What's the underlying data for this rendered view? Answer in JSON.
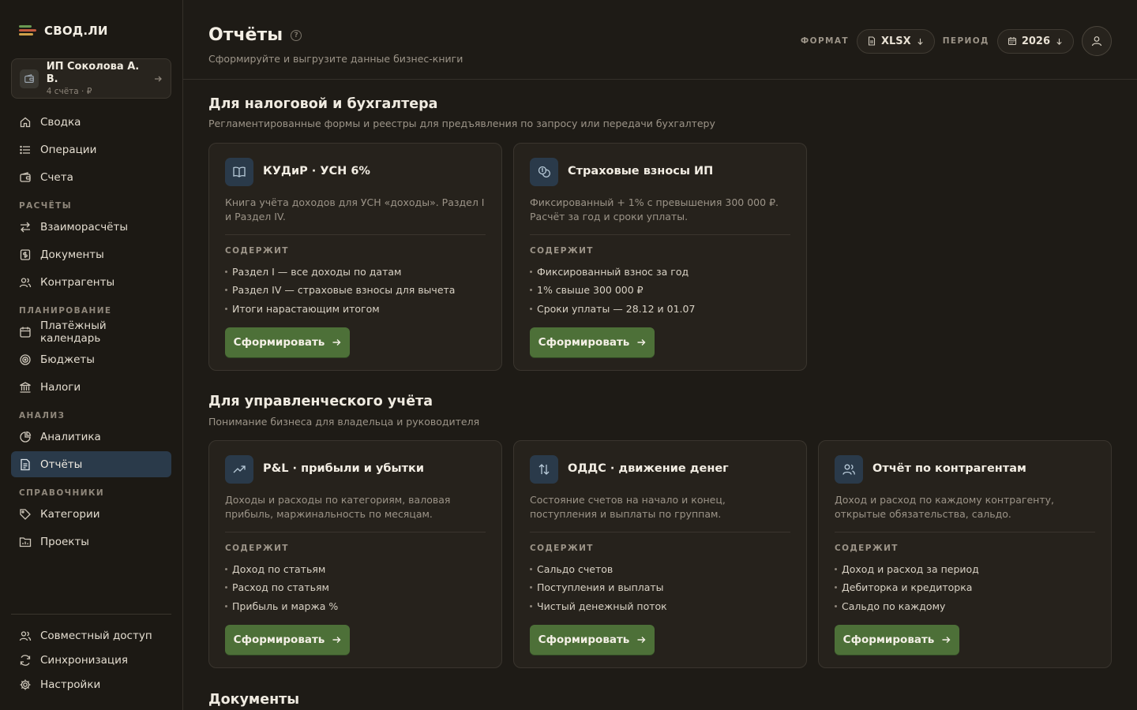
{
  "app": {
    "name": "СВОД.ЛИ"
  },
  "account": {
    "name": "ИП Соколова А. В.",
    "sub": "4 счёта · ₽"
  },
  "nav": {
    "summary": "Сводка",
    "operations": "Операции",
    "accounts": "Счета",
    "section_calc": "РАСЧЁТЫ",
    "settlements": "Взаиморасчёты",
    "documents": "Документы",
    "counterparties": "Контрагенты",
    "section_plan": "ПЛАНИРОВАНИЕ",
    "calendar": "Платёжный календарь",
    "budgets": "Бюджеты",
    "taxes": "Налоги",
    "section_analysis": "АНАЛИЗ",
    "analytics": "Аналитика",
    "reports": "Отчёты",
    "section_refs": "СПРАВОЧНИКИ",
    "categories": "Категории",
    "projects": "Проекты",
    "sharing": "Совместный доступ",
    "sync": "Синхронизация",
    "settings": "Настройки"
  },
  "header": {
    "title": "Отчёты",
    "help": "?",
    "subtitle": "Сформируйте и выгрузите данные бизнес-книги",
    "format_label": "ФОРМАТ",
    "format_value": "XLSX",
    "period_label": "ПЕРИОД",
    "period_value": "2026"
  },
  "sections": {
    "tax": {
      "title": "Для налоговой и бухгалтера",
      "subtitle": "Регламентированные формы и реестры для предъявления по запросу или передачи бухгалтеру"
    },
    "mgmt": {
      "title": "Для управленческого учёта",
      "subtitle": "Понимание бизнеса для владельца и руководителя"
    },
    "docs": {
      "title": "Документы"
    }
  },
  "contains_label": "СОДЕРЖИТ",
  "button_label": "Сформировать",
  "cards": {
    "kudir": {
      "title": "КУДиР · УСН 6%",
      "desc": "Книга учёта доходов для УСН «доходы». Раздел I и Раздел IV.",
      "items": [
        "Раздел I — все доходы по датам",
        "Раздел IV — страховые взносы для вычета",
        "Итоги нарастающим итогом"
      ]
    },
    "insurance": {
      "title": "Страховые взносы ИП",
      "desc": "Фиксированный + 1% с превышения 300 000 ₽. Расчёт за год и сроки уплаты.",
      "items": [
        "Фиксированный взнос за год",
        "1% свыше 300 000 ₽",
        "Сроки уплаты — 28.12 и 01.07"
      ]
    },
    "pl": {
      "title": "P&L · прибыли и убытки",
      "desc": "Доходы и расходы по категориям, валовая прибыль, маржинальность по месяцам.",
      "items": [
        "Доход по статьям",
        "Расход по статьям",
        "Прибыль и маржа %"
      ]
    },
    "odds": {
      "title": "ОДДС · движение денег",
      "desc": "Состояние счетов на начало и конец, поступления и выплаты по группам.",
      "items": [
        "Сальдо счетов",
        "Поступления и выплаты",
        "Чистый денежный поток"
      ]
    },
    "cp": {
      "title": "Отчёт по контрагентам",
      "desc": "Доход и расход по каждому контрагенту, открытые обязательства, сальдо.",
      "items": [
        "Доход и расход за период",
        "Дебиторка и кредиторка",
        "Сальдо по каждому"
      ]
    }
  }
}
